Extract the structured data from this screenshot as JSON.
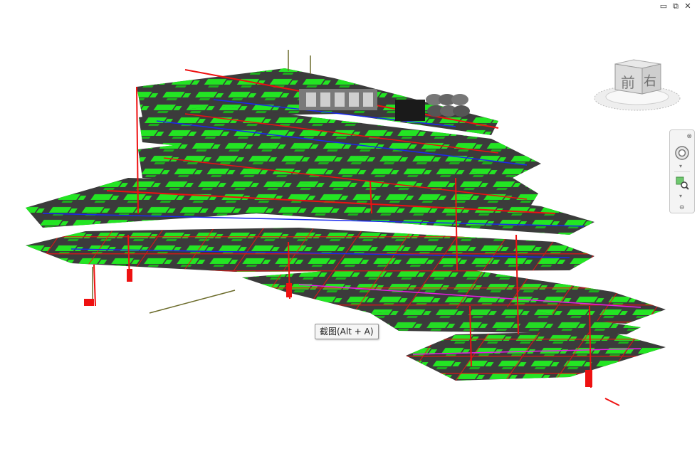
{
  "window_controls": {
    "minimize": "▭",
    "restore": "⧉",
    "close": "✕"
  },
  "viewcube": {
    "front_face": "前",
    "right_face": "右"
  },
  "navigation_bar": {
    "close": "⊗",
    "steering_wheel_icon": "steering-wheel-icon",
    "zoom_icon": "zoom-region-icon",
    "caret": "▾",
    "minimize": "⊖"
  },
  "tooltip": {
    "text": "截图(Alt + A)"
  },
  "colors": {
    "slab": "#3b3b3b",
    "equipment": "#22ee22",
    "piping": "#ee1111",
    "cable_tray": "#1a2aee",
    "conduit": "#e81ee8",
    "background": "#ffffff"
  }
}
